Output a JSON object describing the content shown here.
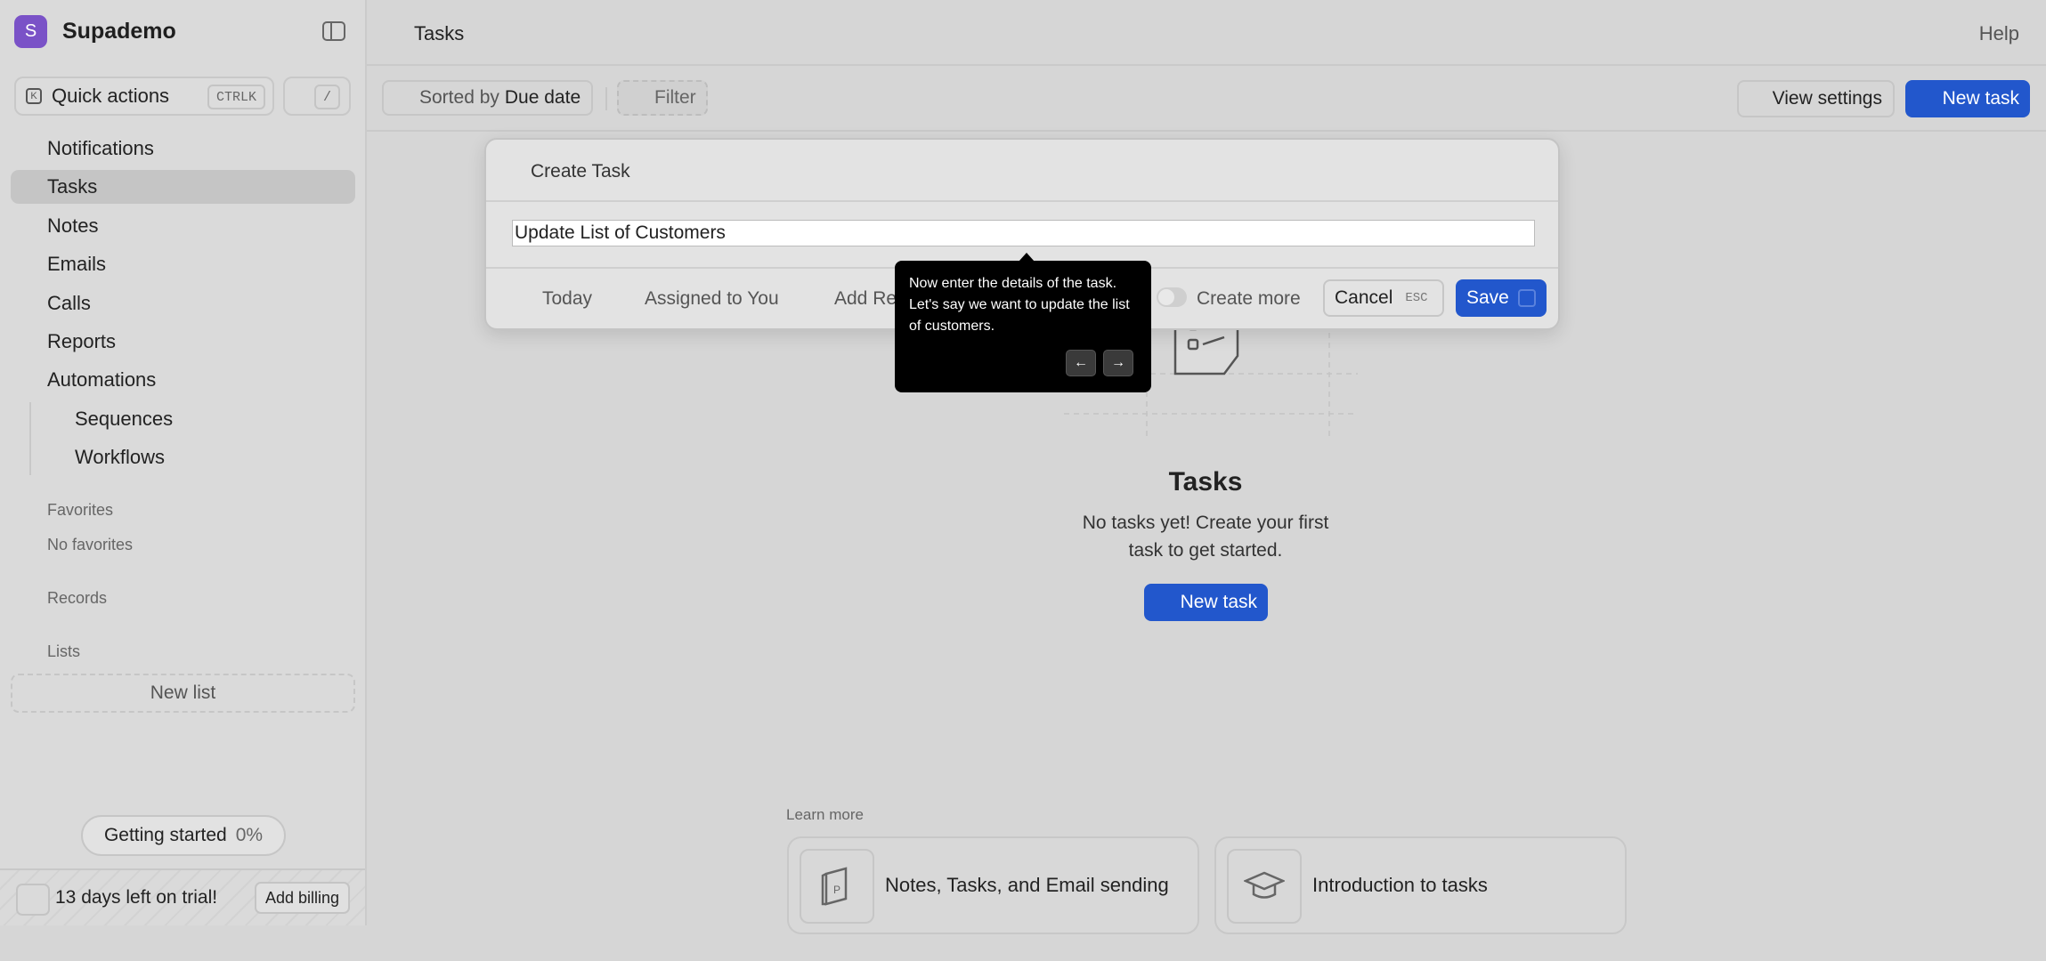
{
  "app": {
    "name": "Supademo",
    "logo_letter": "S"
  },
  "sidebar": {
    "quick_actions": {
      "label": "Quick actions",
      "shortcut": "CTRLK",
      "slash": "/"
    },
    "nav": [
      {
        "label": "Notifications"
      },
      {
        "label": "Tasks",
        "active": true
      },
      {
        "label": "Notes"
      },
      {
        "label": "Emails"
      },
      {
        "label": "Calls"
      },
      {
        "label": "Reports"
      },
      {
        "label": "Automations"
      }
    ],
    "sub_nav": [
      {
        "label": "Sequences"
      },
      {
        "label": "Workflows"
      }
    ],
    "favorites": {
      "heading": "Favorites",
      "empty": "No favorites"
    },
    "records": {
      "heading": "Records"
    },
    "lists": {
      "heading": "Lists",
      "new_list": "New list"
    },
    "getting_started": {
      "label": "Getting started",
      "percent": "0%"
    },
    "trial": {
      "text": "13 days left on trial!",
      "billing": "Add billing"
    }
  },
  "header": {
    "title": "Tasks",
    "help": "Help"
  },
  "toolbar": {
    "sort_prefix": "Sorted by",
    "sort_value": "Due date",
    "filter": "Filter",
    "view_settings": "View settings",
    "new_task": "New task"
  },
  "empty_state": {
    "title": "Tasks",
    "description": "No tasks yet! Create your first task to get started.",
    "button": "New task"
  },
  "learn_more": {
    "heading": "Learn more",
    "cards": [
      {
        "title": "Notes, Tasks, and Email sending",
        "icon": "book-icon"
      },
      {
        "title": "Introduction to tasks",
        "icon": "graduation-cap-icon"
      }
    ]
  },
  "modal": {
    "title": "Create Task",
    "input_value": "Update List of Customers",
    "chips": [
      "Today",
      "Assigned to You",
      "Add Re"
    ],
    "create_more": "Create more",
    "cancel": "Cancel",
    "cancel_shortcut": "ESC",
    "save": "Save"
  },
  "tooltip": {
    "text": "Now enter the details of the task. Let's say we want to update the list of customers.",
    "prev": "←",
    "next": "→"
  },
  "colors": {
    "accent": "#2257cc",
    "logo": "#7a52c7",
    "tooltip_bg": "#000000"
  }
}
